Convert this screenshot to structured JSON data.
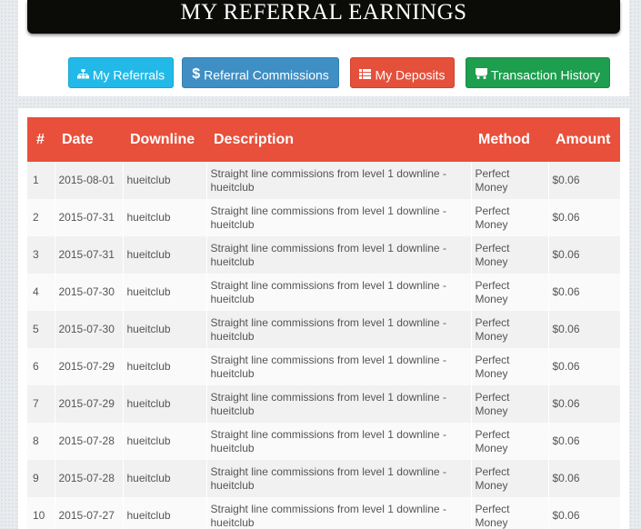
{
  "page": {
    "title": "MY REFERRAL EARNINGS"
  },
  "nav_buttons": [
    {
      "label": "My Referrals",
      "icon": "sitemap-icon",
      "color": "#22b9e8"
    },
    {
      "label": "Referral Commissions",
      "icon": "dollar-icon",
      "color": "#3f8fc4"
    },
    {
      "label": "My Deposits",
      "icon": "list-icon",
      "color": "#e5503b"
    },
    {
      "label": "Transaction History",
      "icon": "cart-icon",
      "color": "#1e9e4f"
    }
  ],
  "table": {
    "header_color": "#e8503b",
    "columns": [
      "#",
      "Date",
      "Downline",
      "Description",
      "Method",
      "Amount"
    ],
    "rows": [
      {
        "num": "1",
        "date": "2015-08-01",
        "downline": "hueitclub",
        "description": "Straight line commissions from level 1 downline - hueitclub",
        "method": "Perfect Money",
        "amount": "$0.06"
      },
      {
        "num": "2",
        "date": "2015-07-31",
        "downline": "hueitclub",
        "description": "Straight line commissions from level 1 downline - hueitclub",
        "method": "Perfect Money",
        "amount": "$0.06"
      },
      {
        "num": "3",
        "date": "2015-07-31",
        "downline": "hueitclub",
        "description": "Straight line commissions from level 1 downline - hueitclub",
        "method": "Perfect Money",
        "amount": "$0.06"
      },
      {
        "num": "4",
        "date": "2015-07-30",
        "downline": "hueitclub",
        "description": "Straight line commissions from level 1 downline - hueitclub",
        "method": "Perfect Money",
        "amount": "$0.06"
      },
      {
        "num": "5",
        "date": "2015-07-30",
        "downline": "hueitclub",
        "description": "Straight line commissions from level 1 downline - hueitclub",
        "method": "Perfect Money",
        "amount": "$0.06"
      },
      {
        "num": "6",
        "date": "2015-07-29",
        "downline": "hueitclub",
        "description": "Straight line commissions from level 1 downline - hueitclub",
        "method": "Perfect Money",
        "amount": "$0.06"
      },
      {
        "num": "7",
        "date": "2015-07-29",
        "downline": "hueitclub",
        "description": "Straight line commissions from level 1 downline - hueitclub",
        "method": "Perfect Money",
        "amount": "$0.06"
      },
      {
        "num": "8",
        "date": "2015-07-28",
        "downline": "hueitclub",
        "description": "Straight line commissions from level 1 downline - hueitclub",
        "method": "Perfect Money",
        "amount": "$0.06"
      },
      {
        "num": "9",
        "date": "2015-07-28",
        "downline": "hueitclub",
        "description": "Straight line commissions from level 1 downline - hueitclub",
        "method": "Perfect Money",
        "amount": "$0.06"
      },
      {
        "num": "10",
        "date": "2015-07-27",
        "downline": "hueitclub",
        "description": "Straight line commissions from level 1 downline - hueitclub",
        "method": "Perfect Money",
        "amount": "$0.06"
      }
    ]
  }
}
